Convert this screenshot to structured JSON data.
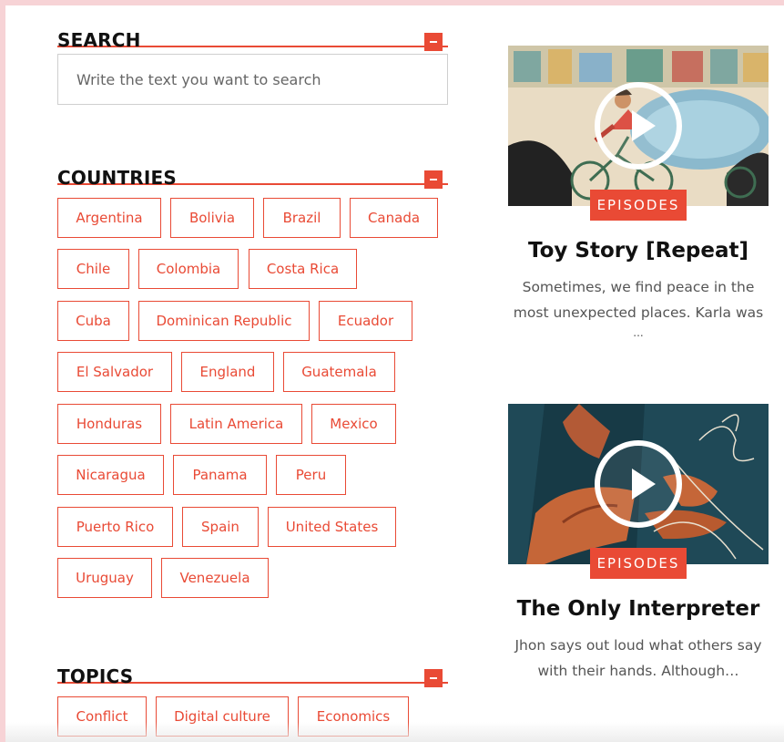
{
  "search": {
    "title": "SEARCH",
    "placeholder": "Write the text you want to search"
  },
  "countries": {
    "title": "COUNTRIES",
    "items": [
      "Argentina",
      "Bolivia",
      "Brazil",
      "Canada",
      "Chile",
      "Colombia",
      "Costa Rica",
      "Cuba",
      "Dominican Republic",
      "Ecuador",
      "El Salvador",
      "England",
      "Guatemala",
      "Honduras",
      "Latin America",
      "Mexico",
      "Nicaragua",
      "Panama",
      "Peru",
      "Puerto Rico",
      "Spain",
      "United States",
      "Uruguay",
      "Venezuela"
    ]
  },
  "topics": {
    "title": "TOPICS",
    "items": [
      "Conflict",
      "Digital culture",
      "Economics"
    ]
  },
  "cards": [
    {
      "badge": "EPISODES",
      "title": "Toy Story [Repeat]",
      "excerpt_lines": [
        "Sometimes, we find peace in the",
        "most unexpected places. Karla was",
        "..."
      ]
    },
    {
      "badge": "EPISODES",
      "title": "The Only Interpreter",
      "excerpt_lines": [
        "Jhon says out loud what others say",
        "with their hands. Although…"
      ]
    }
  ],
  "colors": {
    "accent": "#e94a35",
    "frame": "#f7d3d6",
    "card2_bg": "#1f4957"
  },
  "icons": {
    "collapse": "minus-icon",
    "play": "play-icon"
  }
}
